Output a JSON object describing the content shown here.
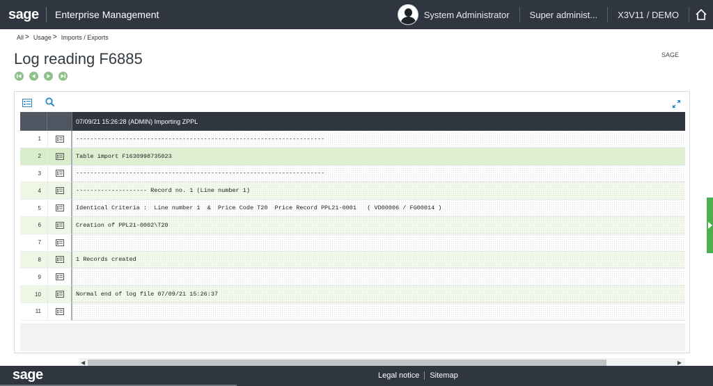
{
  "header": {
    "logo": "sage",
    "app_title": "Enterprise Management",
    "user": "System Administrator",
    "role": "Super administ...",
    "folder": "X3V11 / DEMO"
  },
  "breadcrumb": [
    {
      "label": "All"
    },
    {
      "label": "Usage"
    },
    {
      "label": "Imports / Exports"
    }
  ],
  "breadcrumb_separator": ">",
  "page": {
    "title": "Log reading F6885",
    "right_label": "SAGE"
  },
  "grid": {
    "header_text": "07/09/21 15:26:28 (ADMIN) Importing ZPPL",
    "rows": [
      {
        "num": "1",
        "text": "----------------------------------------------------------------------"
      },
      {
        "num": "2",
        "text": "Table import F1630998735023"
      },
      {
        "num": "3",
        "text": "----------------------------------------------------------------------"
      },
      {
        "num": "4",
        "text": "-------------------- Record no. 1 (Line number 1)"
      },
      {
        "num": "5",
        "text": "Identical Criteria :  Line number 1  &  Price Code T20  Price Record PPL21-0001   ( VD00006 / FG00014 )"
      },
      {
        "num": "6",
        "text": "Creation of PPL21-0002\\T20"
      },
      {
        "num": "7",
        "text": ""
      },
      {
        "num": "8",
        "text": "1 Records created"
      },
      {
        "num": "9",
        "text": ""
      },
      {
        "num": "10",
        "text": "Normal end of log file 07/09/21 15:26:37"
      },
      {
        "num": "11",
        "text": ""
      }
    ]
  },
  "footer": {
    "logo": "sage",
    "legal": "Legal notice",
    "sitemap": "Sitemap"
  },
  "colors": {
    "topbar": "#2f3640",
    "accent_green": "#4caf50",
    "nav_green": "#8ec08a",
    "icon_blue": "#2a86c9"
  }
}
